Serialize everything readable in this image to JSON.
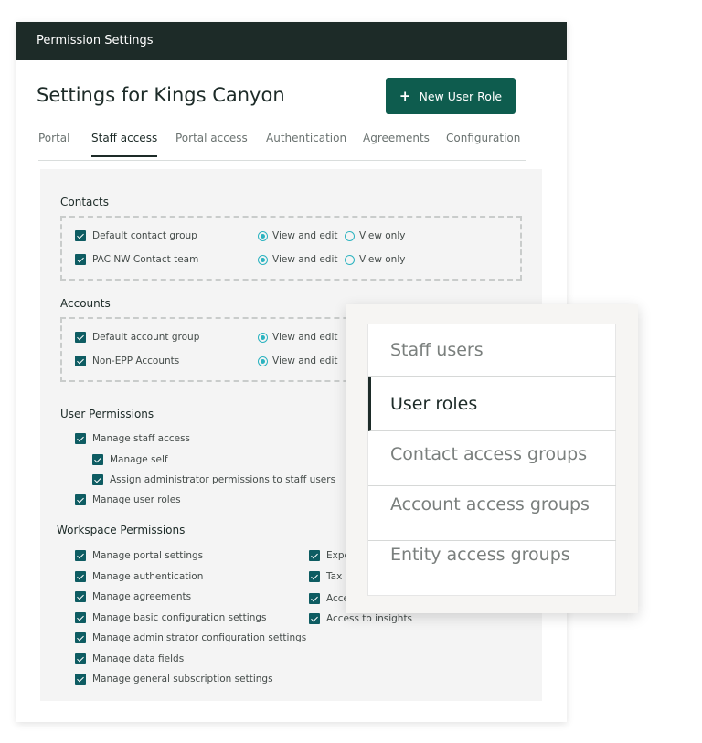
{
  "window": {
    "title": "Permission Settings"
  },
  "page": {
    "title": "Settings for Kings Canyon",
    "new_role_label": "New User Role",
    "new_role_icon": "+"
  },
  "tabs": [
    {
      "label": "Portal"
    },
    {
      "label": "Staff access"
    },
    {
      "label": "Portal access"
    },
    {
      "label": "Authentication"
    },
    {
      "label": "Agreements"
    },
    {
      "label": "Configuration"
    }
  ],
  "contacts": {
    "title": "Contacts",
    "rows": [
      {
        "label": "Default contact group",
        "opt1": "View and edit",
        "opt2": "View only"
      },
      {
        "label": "PAC NW Contact team",
        "opt1": "View and edit",
        "opt2": "View only"
      }
    ]
  },
  "accounts": {
    "title": "Accounts",
    "rows": [
      {
        "label": "Default account group",
        "opt1": "View and edit"
      },
      {
        "label": "Non-EPP Accounts",
        "opt1": "View and edit"
      }
    ]
  },
  "user_permissions": {
    "title": "User Permissions",
    "items": [
      "Manage staff access",
      "Manage self",
      "Assign administrator permissions to staff users",
      "Manage user roles"
    ]
  },
  "workspace_permissions": {
    "title": "Workspace Permissions",
    "left": [
      "Manage portal settings",
      "Manage authentication",
      "Manage agreements",
      "Manage basic configuration settings",
      "Manage administrator configuration settings",
      "Manage data fields",
      "Manage general subscription settings"
    ],
    "right": [
      "Expo",
      "Tax I",
      "Acce",
      "Access to insights"
    ]
  },
  "menu": {
    "items": [
      "Staff users",
      "User roles",
      "Contact access groups",
      "Account access groups",
      "Entity access groups"
    ],
    "active": "User roles"
  },
  "colors": {
    "titlebar": "#1d2b28",
    "primary_button": "#0e5c4e",
    "checkbox": "#0e5c62",
    "radio": "#2bb3c0"
  }
}
